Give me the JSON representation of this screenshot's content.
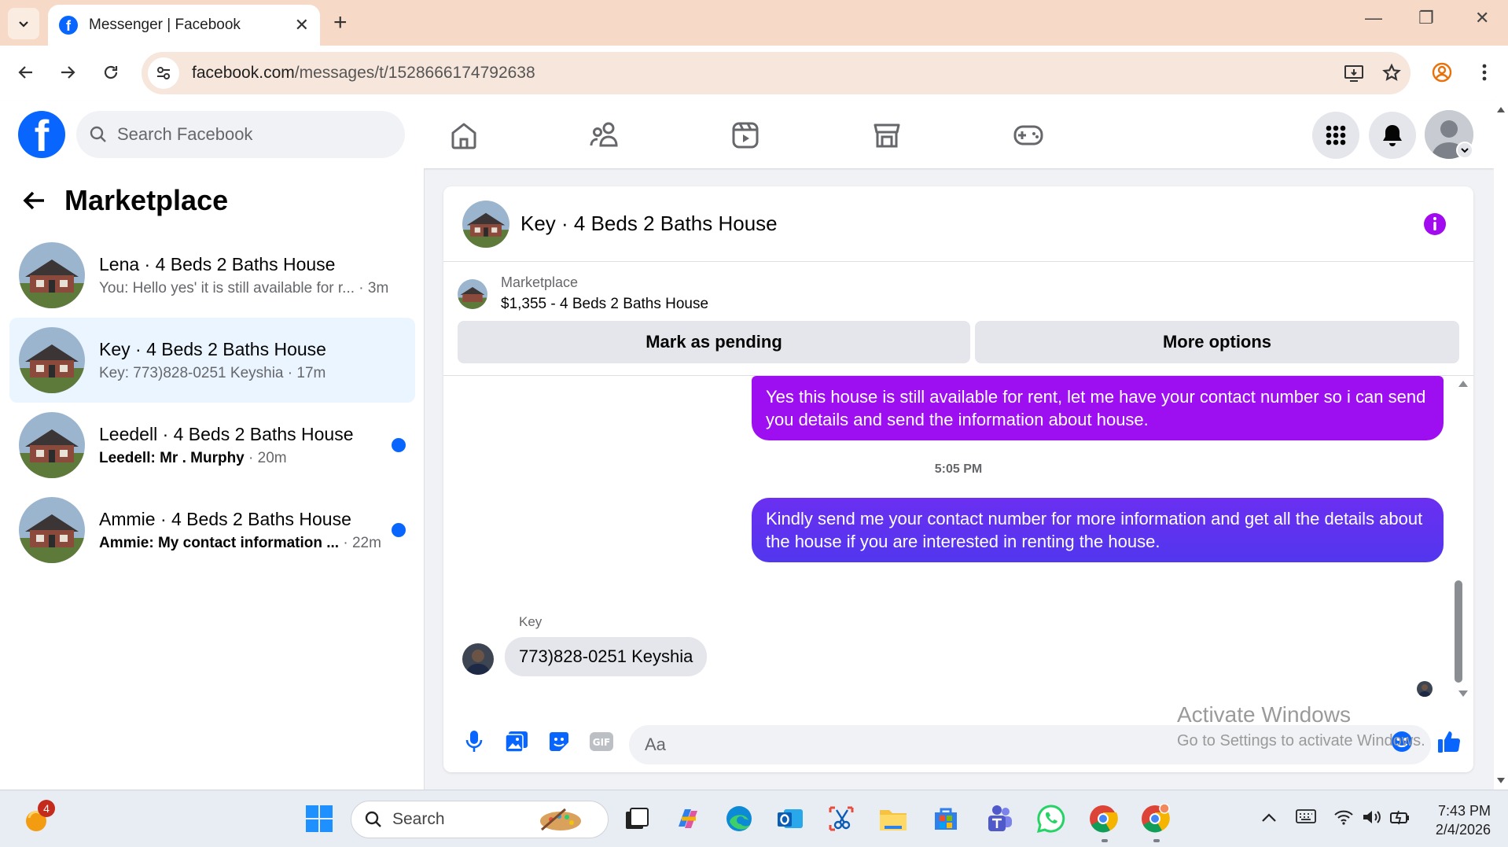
{
  "browser": {
    "tab_title": "Messenger | Facebook",
    "url_host": "facebook.com",
    "url_path": "/messages/t/1528666174792638"
  },
  "fb": {
    "search_placeholder": "Search Facebook"
  },
  "left_panel": {
    "title": "Marketplace",
    "conversations": [
      {
        "name": "Lena · 4 Beds 2 Baths House",
        "preview": "You: Hello yes' it is still available for r...",
        "time": "· 3m",
        "unread": false,
        "active": false
      },
      {
        "name": "Key · 4 Beds 2 Baths House",
        "preview": "Key: 773)828-0251 Keyshia",
        "time": "· 17m",
        "unread": false,
        "active": true
      },
      {
        "name": "Leedell · 4 Beds 2 Baths House",
        "preview": "Leedell: Mr . Murphy",
        "time": "· 20m",
        "unread": true,
        "active": false
      },
      {
        "name": "Ammie · 4 Beds 2 Baths House",
        "preview": "Ammie: My contact information ...",
        "time": "· 22m",
        "unread": true,
        "active": false
      }
    ]
  },
  "chat": {
    "title": "Key · 4 Beds 2 Baths House",
    "marketplace_label": "Marketplace",
    "listing": "$1,355 - 4 Beds 2 Baths House",
    "mark_pending_label": "Mark as pending",
    "more_options_label": "More options",
    "messages": [
      {
        "text": "Yes this house is still available for rent, let me have your contact number so i can send you details and send the information about house."
      },
      {
        "text": "Kindly send me your contact number for more information and get all the details about the house if you are interested in renting the house."
      }
    ],
    "timestamp": "5:05 PM",
    "incoming_sender": "Key",
    "incoming_text": "773)828-0251 Keyshia",
    "composer_placeholder": "Aa",
    "colors": {
      "bubble_top": "#a20bf0",
      "bubble_bottom": "#5b35f0",
      "accent": "#0866ff"
    }
  },
  "watermark": {
    "line1": "Activate Windows",
    "line2": "Go to Settings to activate Windows."
  },
  "taskbar": {
    "search_placeholder": "Search",
    "notification_badge": "4",
    "time": "7:43 PM",
    "date": "2/4/2026"
  }
}
